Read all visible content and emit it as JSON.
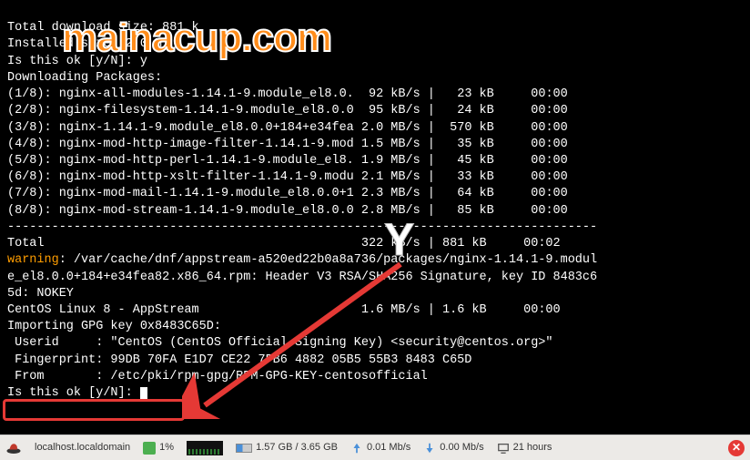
{
  "terminal": {
    "header": [
      "Total download size: 881 k",
      "Installed size: 2.0 M",
      "Is this ok [y/N]: y",
      "Downloading Packages:"
    ],
    "packages": [
      {
        "n": "(1/8)",
        "name": "nginx-all-modules-1.14.1-9.module_el8.0.",
        "spd": " 92 kB/s",
        "size": "  23 kB",
        "time": "00:00"
      },
      {
        "n": "(2/8)",
        "name": "nginx-filesystem-1.14.1-9.module_el8.0.0",
        "spd": " 95 kB/s",
        "size": "  24 kB",
        "time": "00:00"
      },
      {
        "n": "(3/8)",
        "name": "nginx-1.14.1-9.module_el8.0.0+184+e34fea",
        "spd": "2.0 MB/s",
        "size": " 570 kB",
        "time": "00:00"
      },
      {
        "n": "(4/8)",
        "name": "nginx-mod-http-image-filter-1.14.1-9.mod",
        "spd": "1.5 MB/s",
        "size": "  35 kB",
        "time": "00:00"
      },
      {
        "n": "(5/8)",
        "name": "nginx-mod-http-perl-1.14.1-9.module_el8.",
        "spd": "1.9 MB/s",
        "size": "  45 kB",
        "time": "00:00"
      },
      {
        "n": "(6/8)",
        "name": "nginx-mod-http-xslt-filter-1.14.1-9.modu",
        "spd": "2.1 MB/s",
        "size": "  33 kB",
        "time": "00:00"
      },
      {
        "n": "(7/8)",
        "name": "nginx-mod-mail-1.14.1-9.module_el8.0.0+1",
        "spd": "2.3 MB/s",
        "size": "  64 kB",
        "time": "00:00"
      },
      {
        "n": "(8/8)",
        "name": "nginx-mod-stream-1.14.1-9.module_el8.0.0",
        "spd": "2.8 MB/s",
        "size": "  85 kB",
        "time": "00:00"
      }
    ],
    "divider": "--------------------------------------------------------------------------------",
    "total": {
      "label": "Total",
      "spd": "322 kB/s",
      "size": "881 kB",
      "time": "00:02"
    },
    "warning_label": "warning",
    "warning_text_a": ": /var/cache/dnf/appstream-a520ed22b0a8a736/packages/nginx-1.14.1-9.modul",
    "warning_text_b": "e_el8.0.0+184+e34fea82.x86_64.rpm: Header V3 RSA/SHA256 Signature, key ID 8483c6",
    "warning_text_c": "5d: NOKEY",
    "appstream": {
      "name": "CentOS Linux 8 - AppStream",
      "spd": "1.6 MB/s",
      "size": "1.6 kB",
      "time": "00:00"
    },
    "gpg_import": "Importing GPG key 0x8483C65D:",
    "gpg_userid": " Userid     : \"CentOS (CentOS Official Signing Key) <security@centos.org>\"",
    "gpg_finger": " Fingerprint: 99DB 70FA E1D7 CE22 7FB6 4882 05B5 55B3 8483 C65D",
    "gpg_from": " From       : /etc/pki/rpm-gpg/RPM-GPG-KEY-centosofficial",
    "prompt": "Is this ok [y/N]: "
  },
  "watermark": "mainacup.com",
  "annotation": "Y",
  "taskbar": {
    "hostname": "localhost.localdomain",
    "cpu": "1%",
    "ram": "1.57 GB / 3.65 GB",
    "net_up": "0.01 Mb/s",
    "net_down": "0.00 Mb/s",
    "uptime": "21 hours"
  },
  "colors": {
    "warning": "#ff9d00",
    "highlight": "#e53935",
    "watermark": "#ff8c1a"
  }
}
